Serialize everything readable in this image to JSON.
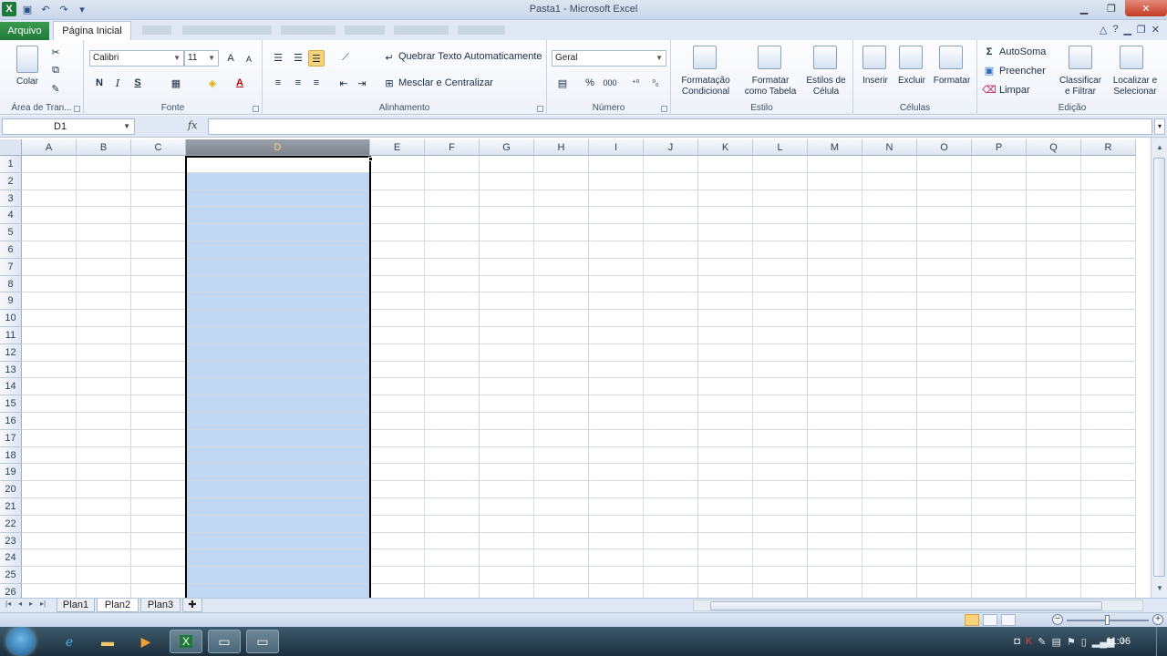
{
  "window": {
    "title": "Pasta1 - Microsoft Excel",
    "app_logo": "X"
  },
  "tabs": {
    "file": "Arquivo",
    "home": "Página Inicial"
  },
  "ribbon": {
    "clipboard": {
      "paste": "Colar",
      "label": "Área de Tran..."
    },
    "font": {
      "name": "Calibri",
      "size": "11",
      "bold": "N",
      "italic": "I",
      "underline": "S",
      "label": "Fonte"
    },
    "alignment": {
      "wrap": "Quebrar Texto Automaticamente",
      "merge": "Mesclar e Centralizar",
      "label": "Alinhamento"
    },
    "number": {
      "format": "Geral",
      "percent": "%",
      "thousands": "000",
      "label": "Número"
    },
    "styles": {
      "conditional": [
        "Formatação",
        "Condicional"
      ],
      "as_table": [
        "Formatar",
        "como Tabela"
      ],
      "cell_styles": [
        "Estilos de",
        "Célula"
      ],
      "label": "Estilo"
    },
    "cells": {
      "insert": "Inserir",
      "delete": "Excluir",
      "format": "Formatar",
      "label": "Células"
    },
    "editing": {
      "autosum": "AutoSoma",
      "fill": "Preencher",
      "clear": "Limpar",
      "sort": [
        "Classificar",
        "e Filtrar"
      ],
      "find": [
        "Localizar e",
        "Selecionar"
      ],
      "label": "Edição"
    }
  },
  "formula_bar": {
    "name_box": "D1",
    "fx": "fx",
    "content": ""
  },
  "grid": {
    "columns": [
      "A",
      "B",
      "C",
      "D",
      "E",
      "F",
      "G",
      "H",
      "I",
      "J",
      "K",
      "L",
      "M",
      "N",
      "O",
      "P",
      "Q",
      "R"
    ],
    "rows": [
      "1",
      "2",
      "3",
      "4",
      "5",
      "6",
      "7",
      "8",
      "9",
      "10",
      "11",
      "12",
      "13",
      "14",
      "15",
      "16",
      "17",
      "18",
      "19",
      "20",
      "21",
      "22",
      "23",
      "24",
      "25",
      "26"
    ],
    "selected_column": "D",
    "active_cell": "D1",
    "selection_color": "#c2d7f3"
  },
  "sheets": {
    "tabs": [
      "Plan1",
      "Plan2",
      "Plan3"
    ],
    "active": "Plan2"
  },
  "status": {
    "zoom_minus": "−",
    "zoom_plus": "+"
  },
  "taskbar": {
    "clock": "11:06"
  },
  "colors": {
    "accent": "#1f7a3a",
    "ribbon_bg": "#eef3fa",
    "selection": "#c2d7f3"
  }
}
